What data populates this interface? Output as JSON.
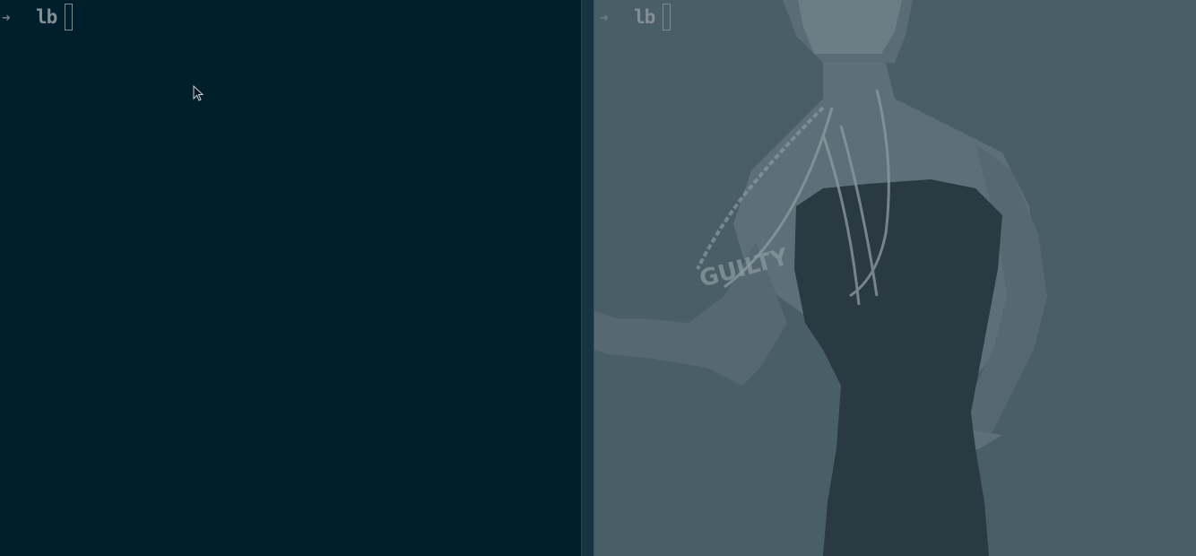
{
  "left_pane": {
    "prompt_arrow": "➜",
    "prompt_dir": "lb"
  },
  "right_pane": {
    "prompt_arrow": "➜",
    "prompt_dir": "lb",
    "wallpaper_text": "GUILTY"
  },
  "icons": {
    "pointer": "mouse-pointer-icon"
  },
  "colors": {
    "left_background": "#001f2c",
    "right_background": "#4a5e68",
    "prompt_text": "#7f8b91"
  }
}
